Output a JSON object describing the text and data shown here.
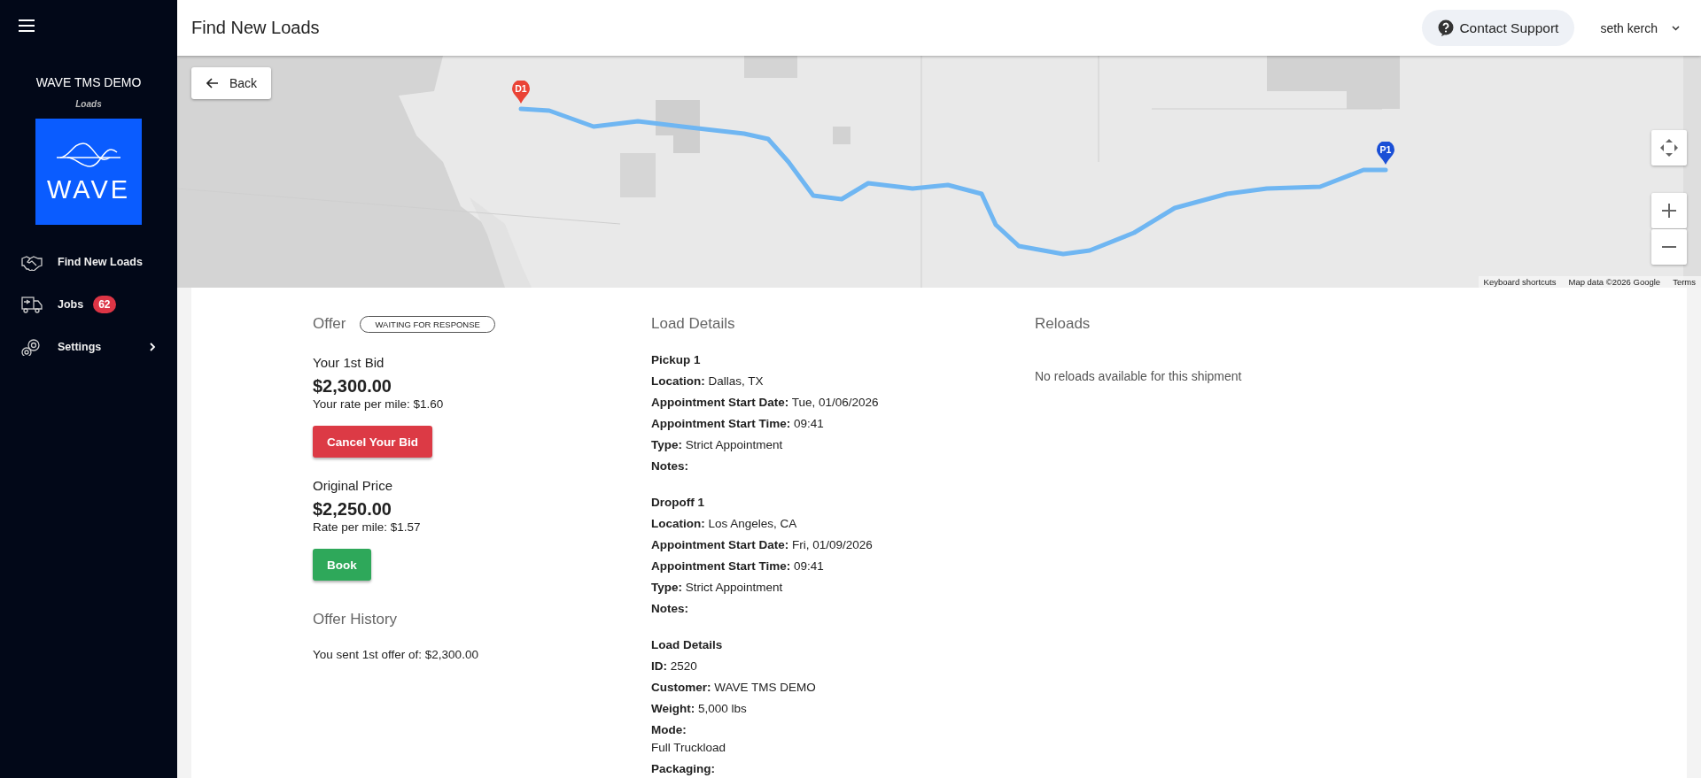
{
  "sidebar": {
    "app_name": "WAVE TMS DEMO",
    "subtitle": "Loads",
    "logo_text": "WAVE",
    "nav": [
      {
        "label": "Find New Loads",
        "kind": "handshake",
        "expandable": false
      },
      {
        "label": "Jobs",
        "kind": "truck",
        "badge": "62",
        "expandable": false
      },
      {
        "label": "Settings",
        "kind": "gears",
        "expandable": true
      }
    ]
  },
  "header": {
    "title": "Find New Loads",
    "support_button": "Contact Support",
    "user": "seth kerch"
  },
  "map": {
    "back_button": "Back",
    "markers": [
      {
        "label": "D1",
        "color": "#ea4335"
      },
      {
        "label": "P1",
        "color": "#1a4fd6"
      }
    ],
    "attribution": [
      "Keyboard shortcuts",
      "Map data ©2026 Google",
      "Terms"
    ]
  },
  "offer": {
    "heading": "Offer",
    "status": "WAITING FOR RESPONSE",
    "bids": [
      {
        "label": "Your 1st Bid",
        "amount": "$2,300.00",
        "rate_label": "Your rate per mile:",
        "rate_value": "$1.60",
        "button": "Cancel Your Bid",
        "kind": "danger"
      },
      {
        "label": "Original Price",
        "amount": "$2,250.00",
        "rate_label": "Rate per mile:",
        "rate_value": "$1.57",
        "button": "Book",
        "kind": "success"
      }
    ],
    "history_heading": "Offer History",
    "history": [
      "You sent 1st offer of: $2,300.00"
    ]
  },
  "load_details": {
    "heading": "Load Details",
    "sections": [
      {
        "title": "Pickup 1",
        "fields": [
          {
            "label": "Location:",
            "value": "Dallas, TX"
          },
          {
            "label": "Appointment Start Date:",
            "value": "Tue, 01/06/2026"
          },
          {
            "label": "Appointment Start Time:",
            "value": "09:41"
          },
          {
            "label": "Type:",
            "value": "Strict Appointment"
          },
          {
            "label": "Notes:"
          }
        ]
      },
      {
        "title": "Dropoff 1",
        "fields": [
          {
            "label": "Location:",
            "value": "Los Angeles, CA"
          },
          {
            "label": "Appointment Start Date:",
            "value": "Fri, 01/09/2026"
          },
          {
            "label": "Appointment Start Time:",
            "value": "09:41"
          },
          {
            "label": "Type:",
            "value": "Strict Appointment"
          },
          {
            "label": "Notes:"
          }
        ]
      },
      {
        "title": "Load Details",
        "fields": [
          {
            "label": "ID:",
            "value": "2520"
          },
          {
            "label": "Customer:",
            "value": "WAVE TMS DEMO"
          },
          {
            "label": "Weight:",
            "value": "5,000 lbs"
          },
          {
            "label": "Mode:",
            "value": "Full Truckload",
            "kind": "stacked"
          },
          {
            "label": "Packaging:"
          }
        ]
      }
    ]
  },
  "reloads": {
    "heading": "Reloads",
    "message": "No reloads available for this shipment"
  }
}
